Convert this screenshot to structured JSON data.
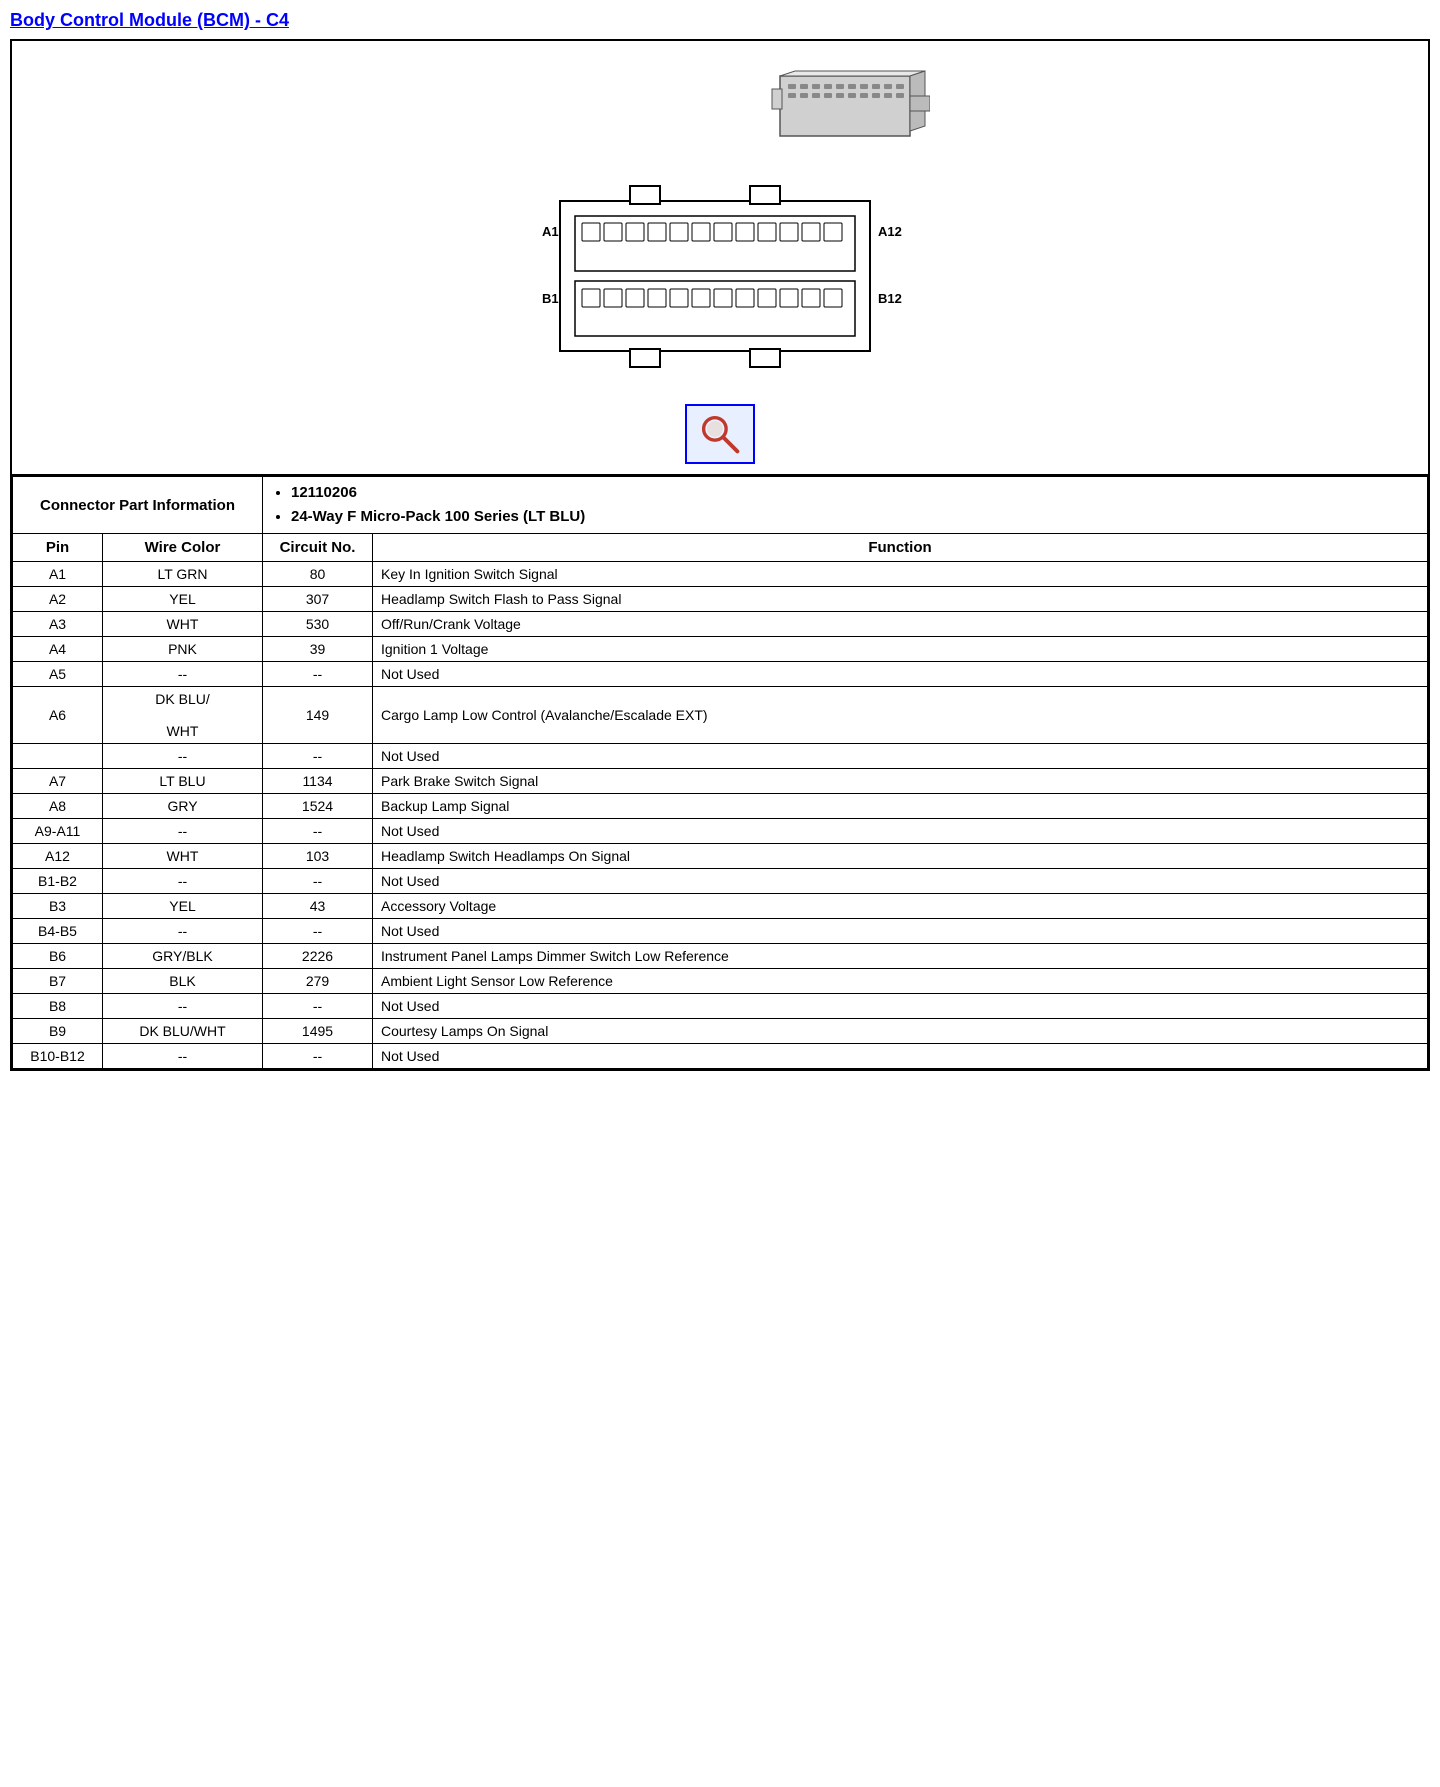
{
  "title": "Body Control Module (BCM) - C4",
  "connector_part_info_label": "Connector Part Information",
  "connector_details": [
    "12110206",
    "24-Way F Micro-Pack 100 Series (LT BLU)"
  ],
  "table_headers": {
    "pin": "Pin",
    "wire_color": "Wire Color",
    "circuit_no": "Circuit No.",
    "function": "Function"
  },
  "rows": [
    {
      "pin": "A1",
      "wire_color": "LT GRN",
      "circuit_no": "80",
      "function": "Key In Ignition Switch Signal"
    },
    {
      "pin": "A2",
      "wire_color": "YEL",
      "circuit_no": "307",
      "function": "Headlamp Switch Flash to Pass Signal"
    },
    {
      "pin": "A3",
      "wire_color": "WHT",
      "circuit_no": "530",
      "function": "Off/Run/Crank Voltage"
    },
    {
      "pin": "A4",
      "wire_color": "PNK",
      "circuit_no": "39",
      "function": "Ignition 1 Voltage"
    },
    {
      "pin": "A5",
      "wire_color": "--",
      "circuit_no": "--",
      "function": "Not Used"
    },
    {
      "pin": "A6",
      "wire_color": "DK BLU/\n\nWHT",
      "circuit_no": "149",
      "function": "Cargo Lamp Low Control (Avalanche/Escalade EXT)"
    },
    {
      "pin": "",
      "wire_color": "--",
      "circuit_no": "--",
      "function": "Not Used"
    },
    {
      "pin": "A7",
      "wire_color": "LT BLU",
      "circuit_no": "1134",
      "function": "Park Brake Switch Signal"
    },
    {
      "pin": "A8",
      "wire_color": "GRY",
      "circuit_no": "1524",
      "function": "Backup Lamp Signal"
    },
    {
      "pin": "A9-A11",
      "wire_color": "--",
      "circuit_no": "--",
      "function": "Not Used"
    },
    {
      "pin": "A12",
      "wire_color": "WHT",
      "circuit_no": "103",
      "function": "Headlamp Switch Headlamps On Signal"
    },
    {
      "pin": "B1-B2",
      "wire_color": "--",
      "circuit_no": "--",
      "function": "Not Used"
    },
    {
      "pin": "B3",
      "wire_color": "YEL",
      "circuit_no": "43",
      "function": "Accessory Voltage"
    },
    {
      "pin": "B4-B5",
      "wire_color": "--",
      "circuit_no": "--",
      "function": "Not Used"
    },
    {
      "pin": "B6",
      "wire_color": "GRY/BLK",
      "circuit_no": "2226",
      "function": "Instrument Panel Lamps Dimmer Switch Low Reference"
    },
    {
      "pin": "B7",
      "wire_color": "BLK",
      "circuit_no": "279",
      "function": "Ambient Light Sensor Low Reference"
    },
    {
      "pin": "B8",
      "wire_color": "--",
      "circuit_no": "--",
      "function": "Not Used"
    },
    {
      "pin": "B9",
      "wire_color": "DK BLU/WHT",
      "circuit_no": "1495",
      "function": "Courtesy Lamps On Signal"
    },
    {
      "pin": "B10-B12",
      "wire_color": "--",
      "circuit_no": "--",
      "function": "Not Used"
    }
  ]
}
